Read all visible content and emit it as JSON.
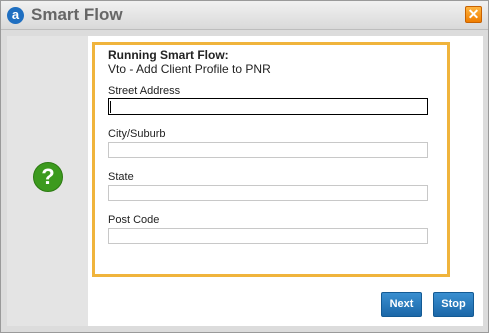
{
  "window": {
    "title": "Smart Flow",
    "logo_letter": "a",
    "close_glyph": "✕"
  },
  "help": {
    "glyph": "?"
  },
  "form": {
    "running_label": "Running Smart Flow:",
    "flow_name": "Vto - Add Client Profile to PNR",
    "fields": [
      {
        "label": "Street Address",
        "value": ""
      },
      {
        "label": "City/Suburb",
        "value": ""
      },
      {
        "label": "State",
        "value": ""
      },
      {
        "label": "Post Code",
        "value": ""
      }
    ]
  },
  "buttons": {
    "next_label": "Next",
    "stop_label": "Stop"
  },
  "colors": {
    "highlight_border": "#f0b43c",
    "button_blue": "#2a7bbd",
    "help_green": "#3c9a1e",
    "close_orange": "#f08c10"
  }
}
